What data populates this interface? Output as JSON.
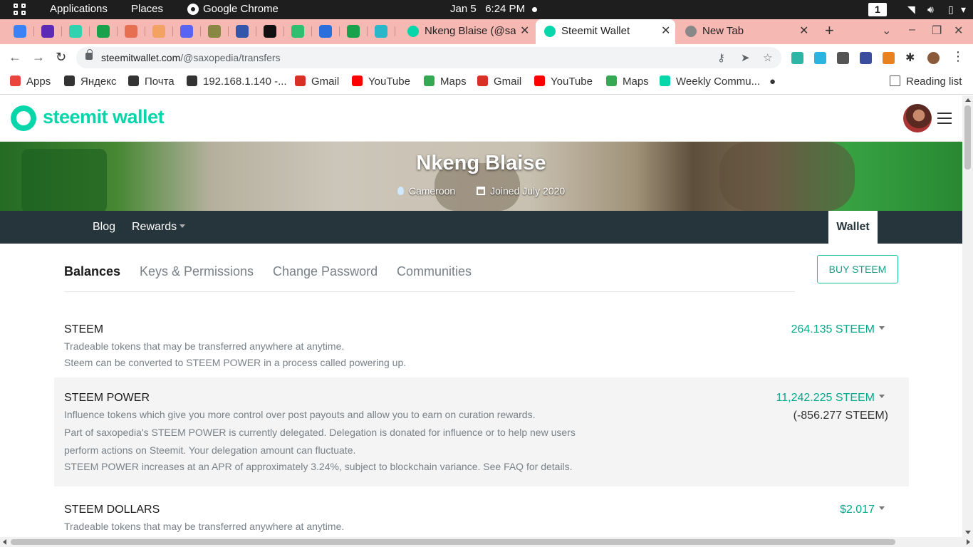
{
  "os_bar": {
    "applications": "Applications",
    "places": "Places",
    "active_app": "Google Chrome",
    "clock": "Jan 5   6:24 PM",
    "workspace": "1"
  },
  "tabs": [
    {
      "title": "Nkeng Blaise (@sax",
      "active": false
    },
    {
      "title": "Steemit Wallet",
      "active": true
    },
    {
      "title": "New Tab",
      "active": false
    }
  ],
  "pinned_tab_colors": [
    "#3b82f6",
    "#5b2bb5",
    "#2fd3b0",
    "#1aa14b",
    "#e76f51",
    "#f4a261",
    "#5865f2",
    "#888844",
    "#3355aa",
    "#111111",
    "#2fbf71",
    "#2a6fdb",
    "#1aa14b",
    "#2ab7ca"
  ],
  "address_bar": {
    "domain": "steemitwallet.com",
    "path": "/@saxopedia/transfers"
  },
  "bookmarks": [
    {
      "label": "Apps",
      "icon": "apps-grid-icon",
      "color": "#e8453c"
    },
    {
      "label": "Яндекс",
      "icon": "globe-icon",
      "color": "#333333"
    },
    {
      "label": "Почта",
      "icon": "globe-icon",
      "color": "#333333"
    },
    {
      "label": "192.168.1.140 -...",
      "icon": "terminal-icon",
      "color": "#333333"
    },
    {
      "label": "Gmail",
      "icon": "gmail-icon",
      "color": "#d93025"
    },
    {
      "label": "YouTube",
      "icon": "youtube-icon",
      "color": "#ff0000"
    },
    {
      "label": "Maps",
      "icon": "maps-icon",
      "color": "#34a853"
    },
    {
      "label": "Gmail",
      "icon": "gmail-icon",
      "color": "#d93025"
    },
    {
      "label": "YouTube",
      "icon": "youtube-icon",
      "color": "#ff0000"
    },
    {
      "label": "Maps",
      "icon": "maps-icon",
      "color": "#34a853"
    },
    {
      "label": "Weekly Commu...",
      "icon": "steemit-icon",
      "color": "#06d6a9"
    }
  ],
  "reading_list": "Reading list",
  "site": {
    "logo": "steemit wallet",
    "brand_color": "#06d6a9"
  },
  "profile": {
    "name": "Nkeng Blaise",
    "location": "Cameroon",
    "joined": "Joined July 2020"
  },
  "user_nav": {
    "blog": "Blog",
    "rewards": "Rewards",
    "wallet": "Wallet"
  },
  "wallet_tabs": {
    "balances": "Balances",
    "keys": "Keys & Permissions",
    "password": "Change Password",
    "communities": "Communities",
    "buy": "BUY STEEM"
  },
  "balances": {
    "steem": {
      "title": "STEEM",
      "desc1": "Tradeable tokens that may be transferred anywhere at anytime.",
      "desc2": "Steem can be converted to STEEM POWER in a process called powering up.",
      "value": "264.135 STEEM"
    },
    "steem_power": {
      "title": "STEEM POWER",
      "desc1": "Influence tokens which give you more control over post payouts and allow you to earn on curation rewards.",
      "desc2": "Part of saxopedia's STEEM POWER is currently delegated. Delegation is donated for influence or to help new users",
      "desc3": "perform actions on Steemit. Your delegation amount can fluctuate.",
      "desc4": "STEEM POWER increases at an APR of approximately 3.24%, subject to blockchain variance. See FAQ for details.",
      "value": "11,242.225 STEEM",
      "delegated": "(-856.277 STEEM)"
    },
    "steem_dollars": {
      "title": "STEEM DOLLARS",
      "desc1": "Tradeable tokens that may be transferred anywhere at anytime.",
      "value": "$2.017"
    }
  }
}
